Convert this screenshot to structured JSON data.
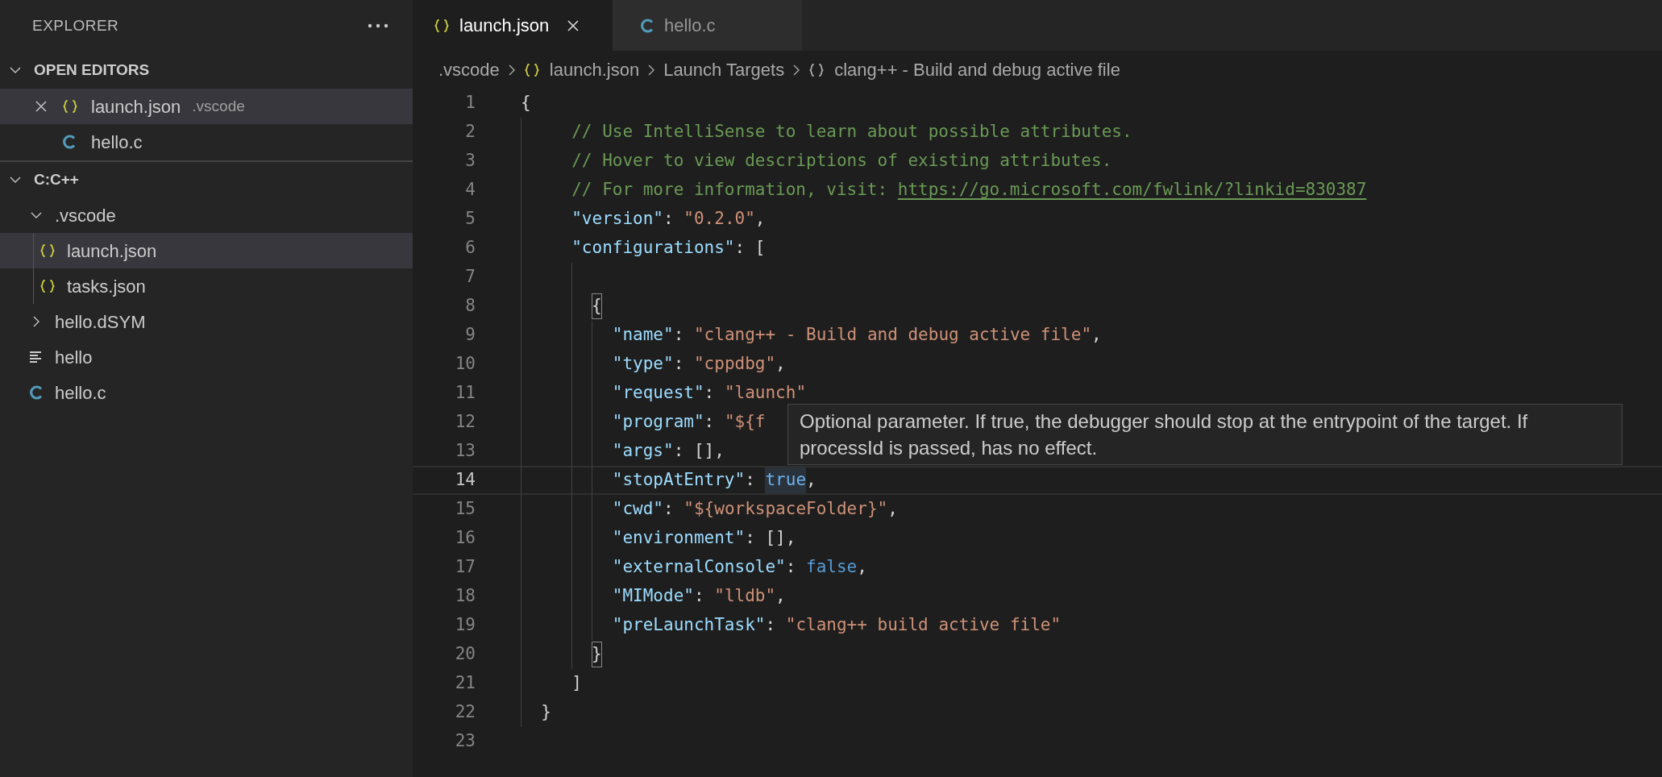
{
  "sidebar": {
    "title": "EXPLORER",
    "open_editors": {
      "title": "OPEN EDITORS",
      "expanded": true,
      "items": [
        {
          "label": "launch.json",
          "description": ".vscode",
          "kind": "json",
          "selected": true,
          "hovered": true
        },
        {
          "label": "hello.c",
          "kind": "c",
          "selected": false,
          "hovered": false
        }
      ]
    },
    "folder": {
      "title": "C:C++",
      "expanded": true,
      "items": [
        {
          "label": ".vscode",
          "kind": "folder",
          "expanded": true,
          "selected": false,
          "children": [
            {
              "label": "launch.json",
              "kind": "json",
              "selected": true
            },
            {
              "label": "tasks.json",
              "kind": "json",
              "selected": false
            }
          ]
        },
        {
          "label": "hello.dSYM",
          "kind": "folder",
          "expanded": false,
          "selected": false
        },
        {
          "label": "hello",
          "kind": "text",
          "selected": false
        },
        {
          "label": "hello.c",
          "kind": "c",
          "selected": false
        }
      ]
    }
  },
  "tabs": [
    {
      "label": "launch.json",
      "kind": "json",
      "selected": true
    },
    {
      "label": "hello.c",
      "kind": "c",
      "selected": false
    }
  ],
  "breadcrumb": [
    {
      "label": ".vscode",
      "kind": "folder"
    },
    {
      "label": "launch.json",
      "kind": "json"
    },
    {
      "label": "Launch Targets",
      "kind": "group"
    },
    {
      "label": "clang++ - Build and debug active file",
      "kind": "braces"
    }
  ],
  "editor": {
    "lines": [
      {
        "number": "1",
        "current": false,
        "tokens": [
          {
            "kind": "punct",
            "text": "{"
          }
        ]
      },
      {
        "number": "2",
        "current": false,
        "tokens": [
          {
            "kind": "comment",
            "text": "     // Use IntelliSense to learn about possible attributes."
          }
        ]
      },
      {
        "number": "3",
        "current": false,
        "tokens": [
          {
            "kind": "comment",
            "text": "     // Hover to view descriptions of existing attributes."
          }
        ]
      },
      {
        "number": "4",
        "current": false,
        "tokens": [
          {
            "kind": "comment",
            "text": "     // For more information, visit: "
          },
          {
            "kind": "link",
            "text": "https://go.microsoft.com/fwlink/?linkid=830387"
          }
        ]
      },
      {
        "number": "5",
        "current": false,
        "tokens": [
          {
            "kind": "key",
            "text": "     \"version\""
          },
          {
            "kind": "punct",
            "text": ": "
          },
          {
            "kind": "string",
            "text": "\"0.2.0\""
          },
          {
            "kind": "punct",
            "text": ","
          }
        ]
      },
      {
        "number": "6",
        "current": false,
        "tokens": [
          {
            "kind": "key",
            "text": "     \"configurations\""
          },
          {
            "kind": "punct",
            "text": ": ["
          }
        ]
      },
      {
        "number": "7",
        "current": false
      },
      {
        "number": "8",
        "current": false,
        "tokens": [
          {
            "kind": "bracket_match",
            "text": "{"
          }
        ]
      },
      {
        "number": "9",
        "current": false,
        "tokens": [
          {
            "kind": "key",
            "text": "         \"name\""
          },
          {
            "kind": "punct",
            "text": ": "
          },
          {
            "kind": "string",
            "text": "\"clang++ - Build and debug active file\""
          },
          {
            "kind": "punct",
            "text": ","
          }
        ]
      },
      {
        "number": "10",
        "current": false,
        "tokens": [
          {
            "kind": "key",
            "text": "         \"type\""
          },
          {
            "kind": "punct",
            "text": ": "
          },
          {
            "kind": "string",
            "text": "\"cppdbg\""
          },
          {
            "kind": "punct",
            "text": ","
          }
        ]
      },
      {
        "number": "11",
        "current": false,
        "tokens": [
          {
            "kind": "key",
            "text": "         \"request\""
          },
          {
            "kind": "punct",
            "text": ": "
          },
          {
            "kind": "string",
            "text": "\"launch\""
          }
        ]
      },
      {
        "number": "12",
        "current": false,
        "tokens": [
          {
            "kind": "key",
            "text": "         \"program\""
          },
          {
            "kind": "punct",
            "text": ": "
          },
          {
            "kind": "string",
            "text": "\"${f"
          }
        ]
      },
      {
        "number": "13",
        "current": false,
        "tokens": [
          {
            "kind": "key",
            "text": "         \"args\""
          },
          {
            "kind": "punct",
            "text": ": [],"
          }
        ]
      },
      {
        "number": "14",
        "current": true,
        "tokens": [
          {
            "kind": "key",
            "text": "         \"stopAtEntry\""
          },
          {
            "kind": "punct",
            "text": ": "
          },
          {
            "kind": "keyword_highlight",
            "text": "true"
          },
          {
            "kind": "punct",
            "text": ","
          }
        ]
      },
      {
        "number": "15",
        "current": false,
        "tokens": [
          {
            "kind": "key",
            "text": "         \"cwd\""
          },
          {
            "kind": "punct",
            "text": ": "
          },
          {
            "kind": "string",
            "text": "\"${workspaceFolder}\""
          },
          {
            "kind": "punct",
            "text": ","
          }
        ]
      },
      {
        "number": "16",
        "current": false,
        "tokens": [
          {
            "kind": "key",
            "text": "         \"environment\""
          },
          {
            "kind": "punct",
            "text": ": [],"
          }
        ]
      },
      {
        "number": "17",
        "current": false,
        "tokens": [
          {
            "kind": "key",
            "text": "         \"externalConsole\""
          },
          {
            "kind": "punct",
            "text": ": "
          },
          {
            "kind": "keyword",
            "text": "false"
          },
          {
            "kind": "punct",
            "text": ","
          }
        ]
      },
      {
        "number": "18",
        "current": false,
        "tokens": [
          {
            "kind": "key",
            "text": "         \"MIMode\""
          },
          {
            "kind": "punct",
            "text": ": "
          },
          {
            "kind": "string",
            "text": "\"lldb\""
          },
          {
            "kind": "punct",
            "text": ","
          }
        ]
      },
      {
        "number": "19",
        "current": false,
        "tokens": [
          {
            "kind": "key",
            "text": "         \"preLaunchTask\""
          },
          {
            "kind": "punct",
            "text": ": "
          },
          {
            "kind": "string",
            "text": "\"clang++ build active file\""
          }
        ]
      },
      {
        "number": "20",
        "current": false,
        "tokens": [
          {
            "kind": "bracket_match",
            "text": "}"
          }
        ]
      },
      {
        "number": "21",
        "current": false,
        "tokens": [
          {
            "kind": "punct",
            "text": "     ]"
          }
        ]
      },
      {
        "number": "22",
        "current": false,
        "tokens": [
          {
            "kind": "punct",
            "text": "  }"
          }
        ]
      },
      {
        "number": "23",
        "current": false
      }
    ],
    "hover": "Optional parameter. If true, the debugger should stop at the entrypoint of the target. If processId is passed, has no effect."
  }
}
